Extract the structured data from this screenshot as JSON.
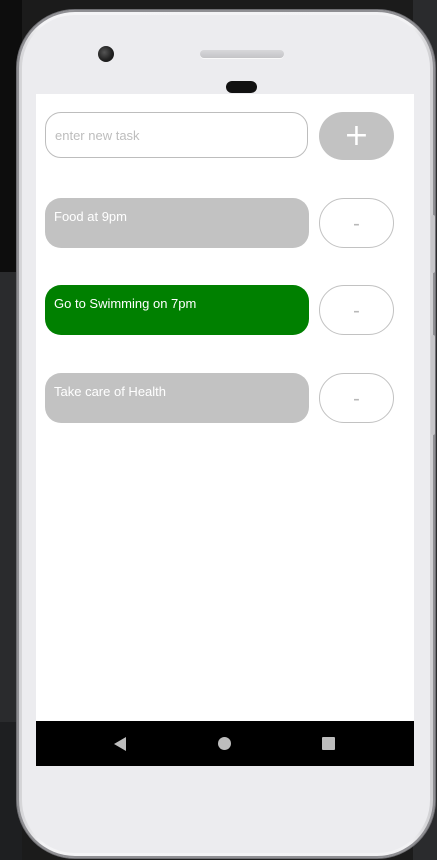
{
  "app": {
    "input": {
      "placeholder": "enter new task",
      "value": ""
    },
    "add_button_label": "+",
    "remove_button_label": "-",
    "tasks": [
      {
        "text": "Food at 9pm",
        "color": "#c2c2c2"
      },
      {
        "text": "Go to Swimming on 7pm",
        "color": "#008000"
      },
      {
        "text": "Take care of Health",
        "color": "#c2c2c2"
      }
    ]
  },
  "colors": {
    "pill_default": "#c2c2c2",
    "pill_selected": "#008000",
    "nav_bar": "#000000",
    "nav_icon": "#bdbdbd"
  },
  "nav": {
    "icons": [
      "back-icon",
      "home-icon",
      "recents-icon"
    ]
  }
}
